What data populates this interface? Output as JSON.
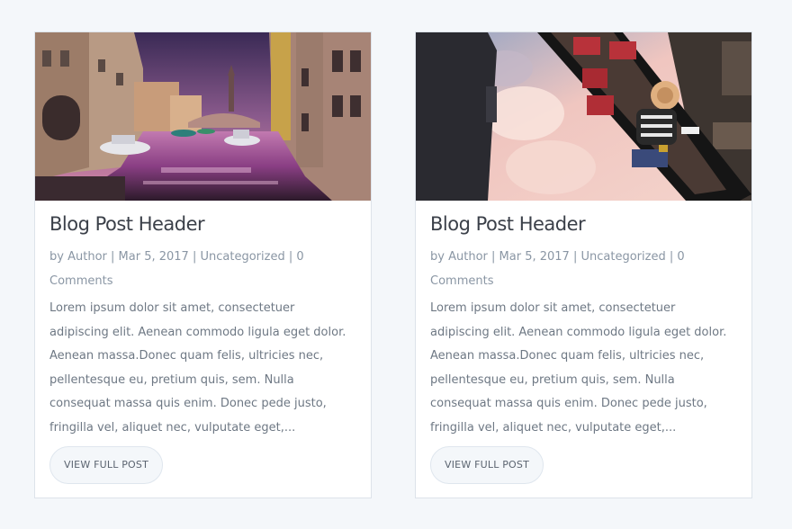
{
  "posts": [
    {
      "title": "Blog Post Header",
      "meta": {
        "by": "by",
        "author": "Author",
        "date": "Mar 5, 2017",
        "category": "Uncategorized",
        "comments": "0 Comments",
        "separator": "|"
      },
      "excerpt": "Lorem ipsum dolor sit amet, consectetuer adipiscing elit. Aenean commodo ligula eget dolor. Aenean massa.Donec quam felis, ultricies nec, pellentesque eu, pretium quis, sem. Nulla consequat massa quis enim. Donec pede justo, fringilla vel, aliquet nec, vulputate eget,...",
      "button_label": "VIEW FULL POST",
      "image_label": "venice-canal-photo"
    },
    {
      "title": "Blog Post Header",
      "meta": {
        "by": "by",
        "author": "Author",
        "date": "Mar 5, 2017",
        "category": "Uncategorized",
        "comments": "0 Comments",
        "separator": "|"
      },
      "excerpt": "Lorem ipsum dolor sit amet, consectetuer adipiscing elit. Aenean commodo ligula eget dolor. Aenean massa.Donec quam felis, ultricies nec, pellentesque eu, pretium quis, sem. Nulla consequat massa quis enim. Donec pede justo, fringilla vel, aliquet nec, vulputate eget,...",
      "button_label": "VIEW FULL POST",
      "image_label": "gondola-from-above-photo"
    }
  ],
  "colors": {
    "background": "#f4f7fa",
    "card": "#ffffff",
    "title": "#3b4049",
    "meta": "#8a96a4",
    "text": "#6e7884"
  }
}
